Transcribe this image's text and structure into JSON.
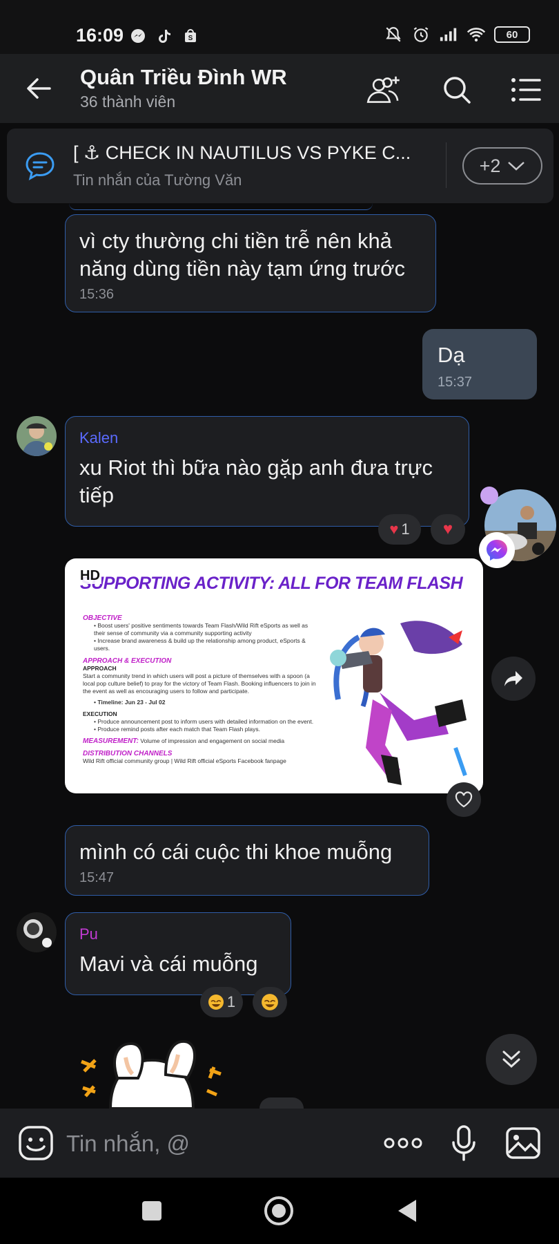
{
  "status_bar": {
    "time": "16:09",
    "battery": "60",
    "left_icons": [
      "messenger-icon",
      "tiktok-icon",
      "shopee-icon"
    ],
    "right_icons": [
      "mute-bell-icon",
      "alarm-icon",
      "signal-icon",
      "wifi-icon",
      "battery-icon"
    ]
  },
  "header": {
    "title": "Quân Triều Đình WR",
    "subtitle": "36 thành viên",
    "icons": [
      "back-arrow-icon",
      "add-member-icon",
      "search-icon",
      "menu-icon"
    ]
  },
  "pinned": {
    "title": "[ ⚓ CHECK IN NAUTILUS VS PYKE C...",
    "subtitle": "Tin nhắn của Tường Văn",
    "more_label": "+2"
  },
  "messages": {
    "m1": {
      "text": "vì cty thường chi tiền trễ nên khả năng dùng tiền này tạm ứng trước",
      "time": "15:36"
    },
    "m2": {
      "text": "Dạ",
      "time": "15:37"
    },
    "m3": {
      "sender": "Kalen",
      "sender_color": "#5b6bff",
      "text": "xu Riot thì bữa nào gặp anh đưa trực tiếp",
      "reaction_count": "1"
    },
    "m4": {
      "hd": "HD",
      "slide_title": "SUPPORTING ACTIVITY: ALL FOR TEAM FLASH",
      "objective_h": "OBJECTIVE",
      "obj1": "Boost users' positive sentiments towards Team Flash/Wild Rift eSports as well as their sense of community via a community supporting activity",
      "obj2": "Increase brand awareness & build up the relationship among product, eSports & users.",
      "approach_h": "APPROACH & EXECUTION",
      "approach_sub": "APPROACH",
      "approach_text": "Start a community trend in which users will post a picture of themselves with a spoon (a local pop culture belief) to pray for the victory of Team Flash. Booking influencers to join in the event as well as encouraging users to follow and participate.",
      "timeline": "Timeline: Jun 23 - Jul 02",
      "execution_sub": "EXECUTION",
      "exec1": "Produce announcement post to inform users with detailed information on the event.",
      "exec2": "Produce remind posts after each match that Team Flash plays.",
      "measurement_h": "MEASUREMENT:",
      "measurement_text": "Volume of impression and engagement on social media",
      "distribution_h": "DISTRIBUTION CHANNELS",
      "distribution_text": "Wild Rift official community group | Wild Rift official eSports Facebook fanpage"
    },
    "m5": {
      "text": "mình có cái cuộc thi khoe muỗng",
      "time": "15:47"
    },
    "m6": {
      "sender": "Pu",
      "sender_color": "#c23bd4",
      "text": "Mavi và cái muỗng",
      "reaction_count": "1"
    }
  },
  "composer": {
    "placeholder": "Tin nhắn, @",
    "icons": [
      "sticker-icon",
      "more-icon",
      "microphone-icon",
      "image-icon"
    ]
  },
  "nav": {
    "icons": [
      "recents-icon",
      "home-icon",
      "back-icon"
    ]
  },
  "colors": {
    "bubble_border": "#2f5da8",
    "my_bubble": "#3b4654",
    "background": "#0c0c0d"
  }
}
